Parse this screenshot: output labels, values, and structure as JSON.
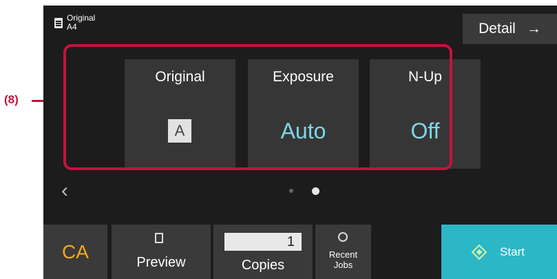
{
  "annotation": {
    "label": "(8)"
  },
  "original_info": {
    "title": "Original",
    "size": "A4"
  },
  "detail_button": {
    "label": "Detail",
    "arrow": "→"
  },
  "tiles": [
    {
      "label": "Original",
      "value": "A"
    },
    {
      "label": "Exposure",
      "value": "Auto"
    },
    {
      "label": "N-Up",
      "value": "Off"
    }
  ],
  "pager": {
    "prev_icon": "chevron-left-icon",
    "pages": 2,
    "current_page": 2
  },
  "bottom_bar": {
    "ca_label": "CA",
    "preview_label": "Preview",
    "copies_value": "1",
    "copies_label": "Copies",
    "recent_line1": "Recent",
    "recent_line2": "Jobs",
    "start_label": "Start"
  },
  "colors": {
    "accent_highlight": "#c8103e",
    "value_text": "#7fd6e6",
    "ca_text": "#f6a81c",
    "start_bg": "#2cb7c7"
  }
}
